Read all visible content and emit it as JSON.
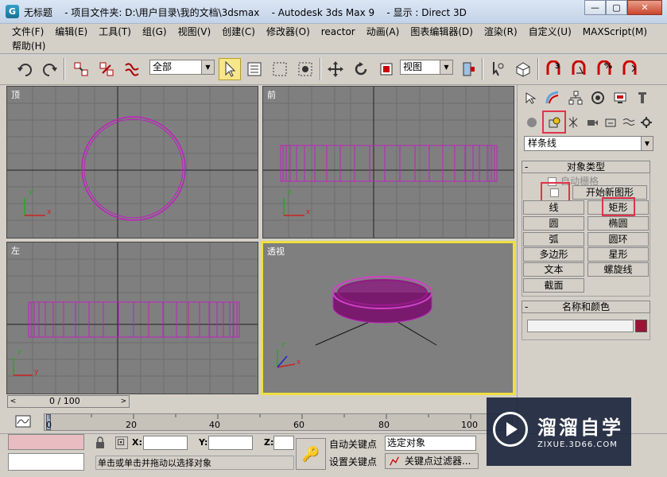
{
  "window": {
    "title": "无标题    - 项目文件夹: D:\\用户目录\\我的文档\\3dsmax    - Autodesk 3ds Max 9    - 显示 : Direct 3D",
    "icon": "3ds-max-logo-icon",
    "minimize": "—",
    "maximize": "▢",
    "close": "✕"
  },
  "menu": {
    "row1": [
      "文件(F)",
      "编辑(E)",
      "工具(T)",
      "组(G)",
      "视图(V)",
      "创建(C)",
      "修改器(O)",
      "reactor",
      "动画(A)",
      "图表编辑器(D)",
      "渲染(R)",
      "自定义(U)",
      "MAXScript(M)"
    ],
    "row2": [
      "帮助(H)"
    ]
  },
  "toolbar": {
    "selection_filter": "全部",
    "reference_coord": "视图"
  },
  "viewports": {
    "top_label": "顶",
    "front_label": "前",
    "left_label": "左",
    "perspective_label": "透视"
  },
  "timeline": {
    "frame_display": "0 / 100",
    "ticks": [
      "0",
      "20",
      "40",
      "60",
      "80",
      "100"
    ]
  },
  "status": {
    "x_label": "X:",
    "y_label": "Y:",
    "z_label": "Z:",
    "message": "单击或单击并拖动以选择对象",
    "auto_key": "自动关键点",
    "set_key": "设置关键点",
    "key_mode": "选定对象",
    "key_filters": "关键点过滤器..."
  },
  "command_panel": {
    "category": "样条线",
    "object_type_header": "对象类型",
    "auto_grid": "自动栅格",
    "start_new_shape": "开始新图形",
    "buttons": [
      "线",
      "矩形",
      "圆",
      "椭圆",
      "弧",
      "圆环",
      "多边形",
      "星形",
      "文本",
      "螺旋线",
      "截面"
    ],
    "name_color_header": "名称和颜色",
    "object_color": "#9a1535"
  },
  "watermark": {
    "title": "溜溜自学",
    "subtitle": "ZIXUE.3D66.COM"
  },
  "colors": {
    "spline_magenta": "#c020c0",
    "active_viewport_border": "#f0e040",
    "highlight_red": "#e0344a"
  }
}
